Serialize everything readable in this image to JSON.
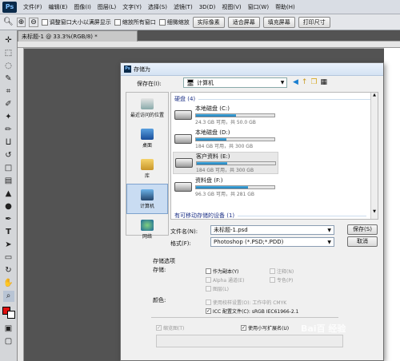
{
  "app": {
    "logo": "Ps"
  },
  "menubar": [
    "文件(F)",
    "编辑(E)",
    "图像(I)",
    "图层(L)",
    "文字(Y)",
    "选择(S)",
    "滤镜(T)",
    "3D(D)",
    "视图(V)",
    "窗口(W)",
    "帮助(H)"
  ],
  "options_bar": {
    "check1": "调整窗口大小以满屏显示",
    "check2": "缩放所有窗口",
    "check3": "细微缩放",
    "btn1": "实际像素",
    "btn2": "适合屏幕",
    "btn3": "填充屏幕",
    "btn4": "打印尺寸"
  },
  "document_tab": "未标题-1 @ 33.3%(RGB/8) *",
  "dialog": {
    "title": "存储为",
    "save_in_label": "保存在(I):",
    "location": "计算机",
    "places": [
      {
        "label": "最近访问的位置",
        "icon": "recent-places-icon"
      },
      {
        "label": "桌面",
        "icon": "desktop-icon"
      },
      {
        "label": "库",
        "icon": "library-icon"
      },
      {
        "label": "计算机",
        "icon": "computer-icon"
      },
      {
        "label": "网络",
        "icon": "network-icon"
      }
    ],
    "group_hdd": "硬盘 (4)",
    "drives": [
      {
        "name": "本地磁盘 (C:)",
        "size": "24.3 GB 可用，共 50.0 GB",
        "used": 0.51
      },
      {
        "name": "本地磁盘 (D:)",
        "size": "184 GB 可用，共 300 GB",
        "used": 0.39
      },
      {
        "name": "客户资料 (E:)",
        "size": "184 GB 可用，共 300 GB",
        "used": 0.39
      },
      {
        "name": "资料盘 (F:)",
        "size": "96.3 GB 可用，共 281 GB",
        "used": 0.66
      }
    ],
    "group_removable": "有可移动存储的设备 (1)",
    "filename_label": "文件名(N):",
    "filename": "未标题-1.psd",
    "format_label": "格式(F):",
    "format": "Photoshop (*.PSD;*.PDD)",
    "save_button": "保存(S)",
    "cancel_button": "取消",
    "save_options_title": "存储选项",
    "save_label": "存储:",
    "opt_copy": "作为副本(Y)",
    "opt_alpha": "Alpha 通道(E)",
    "opt_layers": "图层(L)",
    "opt_notes": "注释(N)",
    "opt_spot": "专色(P)",
    "color_label": "颜色:",
    "opt_proof": "使用校样设置(O): 工作中的 CMYK",
    "opt_icc": "ICC 配置文件(C): sRGB IEC61966-2.1",
    "opt_thumb": "缩览图(T)",
    "opt_lowercase": "使用小写扩展名(U)"
  },
  "watermark": "Bai百 经验"
}
